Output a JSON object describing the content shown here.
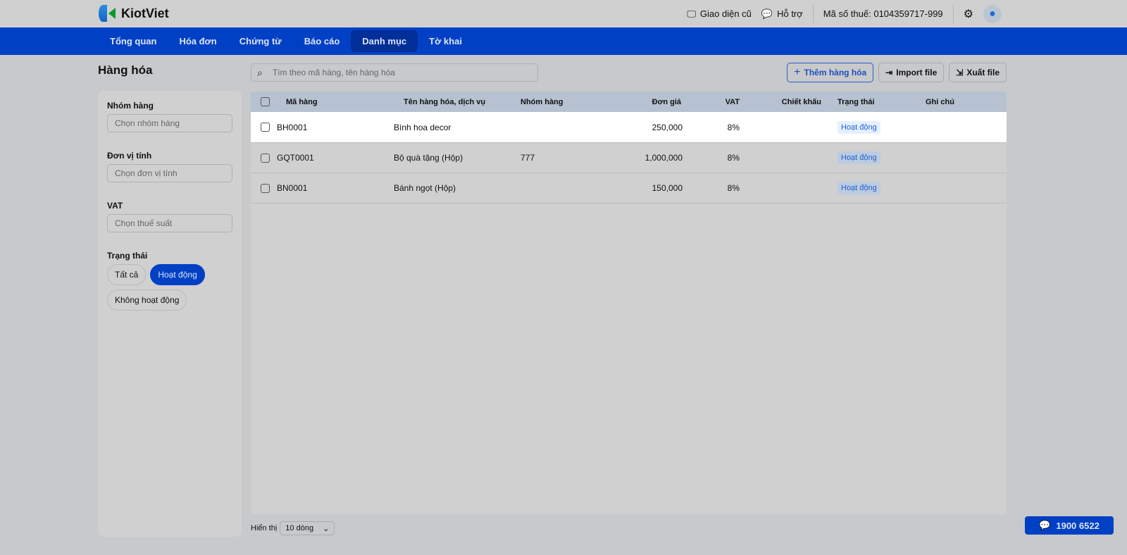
{
  "brand": "KiotViet",
  "topbar": {
    "old_ui": "Giao diện cũ",
    "support": "Hỗ trợ",
    "tax_id": "Mã số thuế: 0104359717-999"
  },
  "nav": [
    "Tổng quan",
    "Hóa đơn",
    "Chứng từ",
    "Báo cáo",
    "Danh mục",
    "Tờ khai"
  ],
  "page_title": "Hàng hóa",
  "filters": {
    "group_label": "Nhóm hàng",
    "group_placeholder": "Chọn nhóm hàng",
    "unit_label": "Đơn vị tính",
    "unit_placeholder": "Chọn đơn vị tính",
    "vat_label": "VAT",
    "vat_placeholder": "Chọn thuế suất",
    "status_label": "Trạng thái",
    "status_options": [
      "Tất cả",
      "Hoạt động",
      "Không hoạt động"
    ]
  },
  "search": {
    "placeholder": "Tìm theo mã hàng, tên hàng hóa"
  },
  "actions": {
    "add": "Thêm hàng hóa",
    "import": "Import file",
    "export": "Xuất file"
  },
  "table": {
    "headers": [
      "Mã hàng",
      "Tên hàng hóa, dịch vụ",
      "Nhóm hàng",
      "Đơn giá",
      "VAT",
      "Chiết khấu",
      "Trạng thái",
      "Ghi chú"
    ],
    "rows": [
      {
        "code": "BH0001",
        "name": "Bình hoa decor",
        "group": "",
        "price": "250,000",
        "vat": "8%",
        "discount": "",
        "status": "Hoạt động",
        "note": ""
      },
      {
        "code": "GQT0001",
        "name": "Bộ quà tặng (Hộp)",
        "group": "777",
        "price": "1,000,000",
        "vat": "8%",
        "discount": "",
        "status": "Hoạt động",
        "note": ""
      },
      {
        "code": "BN0001",
        "name": "Bánh ngọt (Hộp)",
        "group": "",
        "price": "150,000",
        "vat": "8%",
        "discount": "",
        "status": "Hoạt động",
        "note": ""
      }
    ]
  },
  "footer": {
    "show_label": "Hiển thị",
    "page_size": "10 dòng"
  },
  "hotline": "1900 6522"
}
